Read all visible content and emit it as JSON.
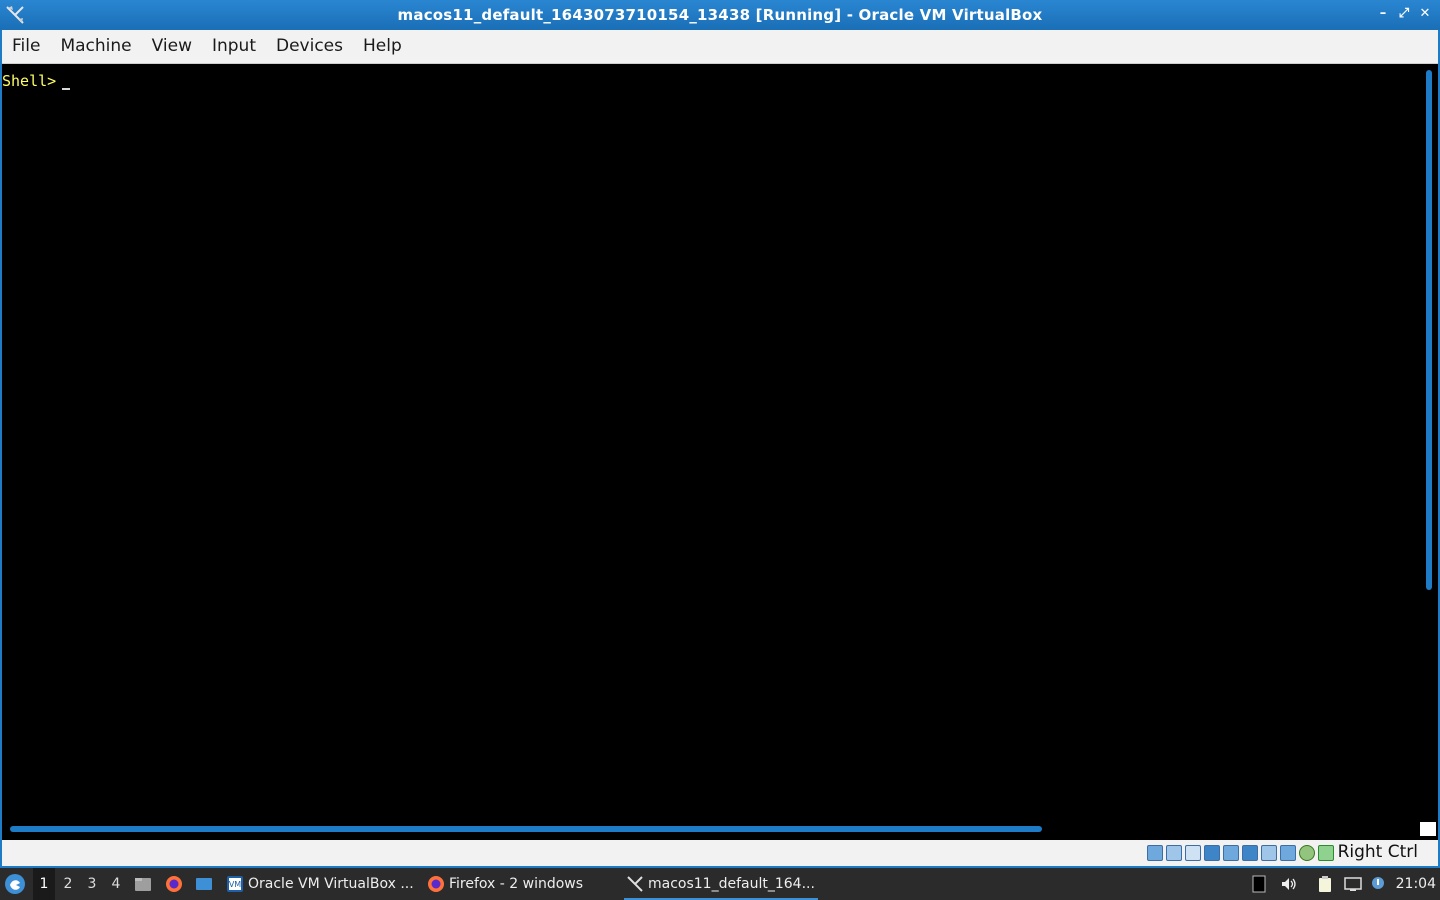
{
  "window": {
    "title": "macos11_default_1643073710154_13438 [Running] - Oracle VM VirtualBox",
    "controls": {
      "minimize": "–",
      "restore": "⤢",
      "close": "✕"
    }
  },
  "menu": {
    "items": [
      "File",
      "Machine",
      "View",
      "Input",
      "Devices",
      "Help"
    ]
  },
  "screen": {
    "prompt": "Shell>",
    "background": "#000000",
    "prompt_color": "#ffff66"
  },
  "statusbar": {
    "icons": [
      "hard-disk-icon",
      "optical-drive-icon",
      "audio-icon",
      "network-icon",
      "usb-icon",
      "shared-folders-icon",
      "display-icon",
      "video-capture-icon",
      "cpu-icon",
      "mouse-integration-icon",
      "keyboard-icon"
    ],
    "host_key": "Right Ctrl"
  },
  "taskbar": {
    "desktops": [
      "1",
      "2",
      "3",
      "4"
    ],
    "active_desktop": "1",
    "tasks": [
      {
        "label": "Oracle VM VirtualBox ...",
        "icon": "virtualbox-icon"
      },
      {
        "label": "Firefox - 2 windows",
        "icon": "firefox-icon"
      },
      {
        "label": "macos11_default_164...",
        "icon": "vm-window-icon"
      }
    ],
    "clock": "21:04"
  },
  "colors": {
    "accent": "#1e7bc6",
    "menubar": "#f2f2f2",
    "taskbar": "#2b2b2b"
  }
}
